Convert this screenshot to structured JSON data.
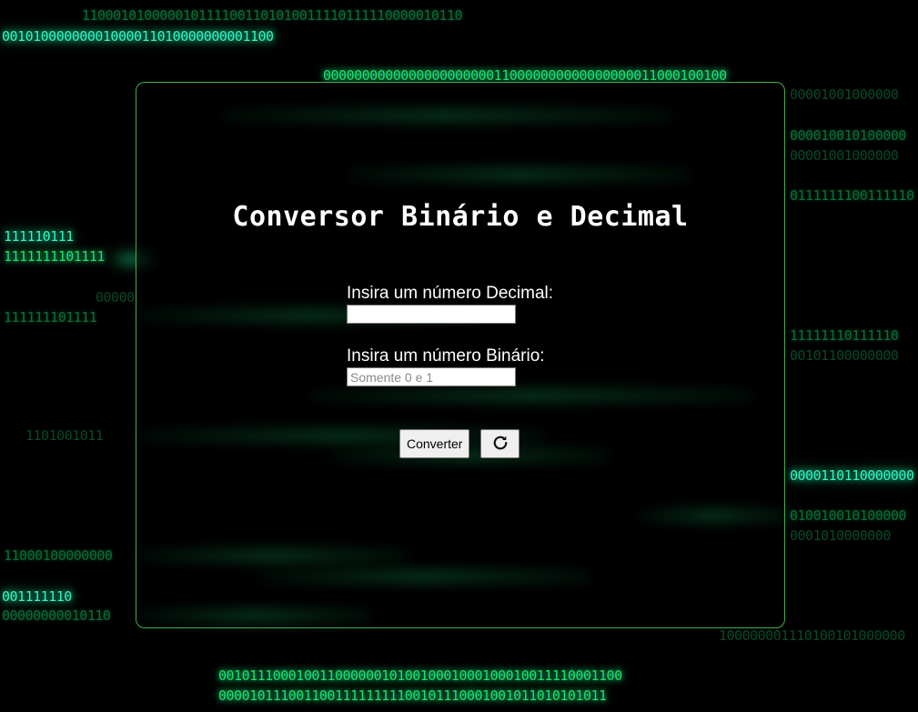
{
  "title": "Conversor Binário e Decimal",
  "decimal": {
    "label": "Insira um número Decimal:",
    "value": "",
    "placeholder": ""
  },
  "binary": {
    "label": "Insira um número Binário:",
    "value": "",
    "placeholder": "Somente 0 e 1"
  },
  "buttons": {
    "convert_label": "Converter",
    "reset_icon": "refresh-icon"
  },
  "background": {
    "streams": [
      "1100010100000101111001101010011110111110000010110",
      "00101000000001000011010000000001100",
      "0000000000000000000000110000000000000000011000100100",
      "00001001000000",
      "000010010100000",
      "00001001000000",
      "0111111100111110",
      "111110111",
      "1111111101111",
      "00000",
      "111111101111",
      "11111110111110",
      "00101100000000",
      "1101001011",
      "0000110110000000",
      "010010010100000",
      "0001010000000",
      "11000100000000",
      "001111110",
      "00000000010110",
      "100000001110100101000000",
      "0010111000100110000001010010001000100010011110001100",
      "00001011100110011111111100101110001001011010101011"
    ]
  },
  "colors": {
    "panel_border": "#3fae4c",
    "matrix_green": "#1fe06a",
    "background": "#000000"
  }
}
